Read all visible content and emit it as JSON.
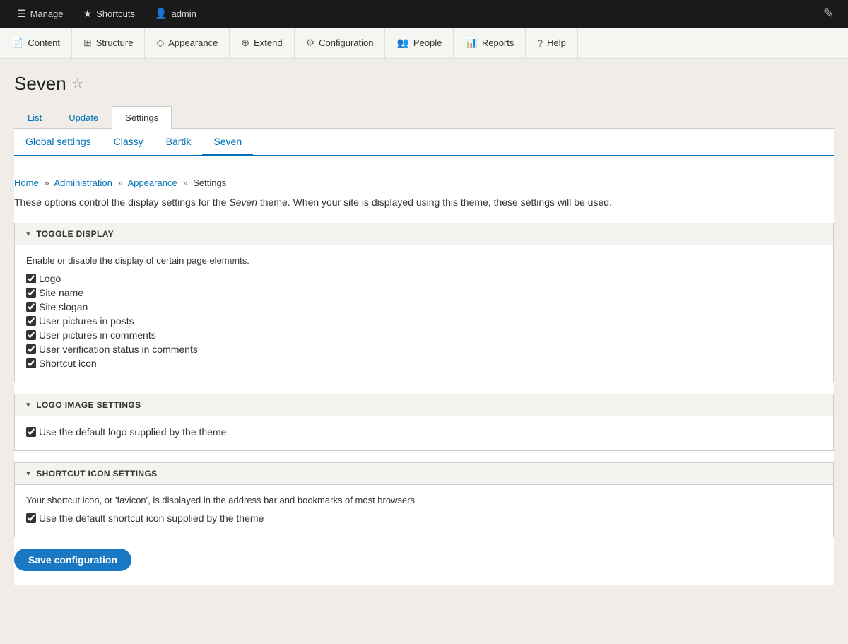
{
  "adminBar": {
    "manage_label": "Manage",
    "shortcuts_label": "Shortcuts",
    "admin_label": "admin",
    "manage_icon": "☰",
    "shortcuts_icon": "★",
    "admin_icon": "👤",
    "edit_icon": "✎"
  },
  "mainNav": {
    "items": [
      {
        "id": "content",
        "label": "Content",
        "icon": "📄"
      },
      {
        "id": "structure",
        "label": "Structure",
        "icon": "⊞"
      },
      {
        "id": "appearance",
        "label": "Appearance",
        "icon": "◇"
      },
      {
        "id": "extend",
        "label": "Extend",
        "icon": "⊕"
      },
      {
        "id": "configuration",
        "label": "Configuration",
        "icon": "⚙"
      },
      {
        "id": "people",
        "label": "People",
        "icon": "👥"
      },
      {
        "id": "reports",
        "label": "Reports",
        "icon": "📊"
      },
      {
        "id": "help",
        "label": "Help",
        "icon": "?"
      }
    ]
  },
  "pageTitle": "Seven",
  "tabs": [
    {
      "id": "list",
      "label": "List",
      "active": false
    },
    {
      "id": "update",
      "label": "Update",
      "active": false
    },
    {
      "id": "settings",
      "label": "Settings",
      "active": true
    }
  ],
  "subTabs": [
    {
      "id": "global-settings",
      "label": "Global settings",
      "active": false
    },
    {
      "id": "classy",
      "label": "Classy",
      "active": false
    },
    {
      "id": "bartik",
      "label": "Bartik",
      "active": false
    },
    {
      "id": "seven",
      "label": "Seven",
      "active": true
    }
  ],
  "breadcrumb": {
    "home": "Home",
    "administration": "Administration",
    "appearance": "Appearance",
    "settings": "Settings"
  },
  "introText": "These options control the display settings for the ",
  "introTheme": "Seven",
  "introTextEnd": " theme. When your site is displayed using this theme, these settings will be used.",
  "toggleDisplay": {
    "legend": "TOGGLE DISPLAY",
    "description": "Enable or disable the display of certain page elements.",
    "items": [
      {
        "id": "logo",
        "label": "Logo",
        "checked": true
      },
      {
        "id": "site-name",
        "label": "Site name",
        "checked": true
      },
      {
        "id": "site-slogan",
        "label": "Site slogan",
        "checked": true
      },
      {
        "id": "user-pictures-posts",
        "label": "User pictures in posts",
        "checked": true
      },
      {
        "id": "user-pictures-comments",
        "label": "User pictures in comments",
        "checked": true
      },
      {
        "id": "user-verification-status",
        "label": "User verification status in comments",
        "checked": true
      },
      {
        "id": "shortcut-icon",
        "label": "Shortcut icon",
        "checked": true
      }
    ]
  },
  "logoImageSettings": {
    "legend": "LOGO IMAGE SETTINGS",
    "items": [
      {
        "id": "default-logo",
        "label": "Use the default logo supplied by the theme",
        "checked": true
      }
    ]
  },
  "shortcutIconSettings": {
    "legend": "SHORTCUT ICON SETTINGS",
    "description": "Your shortcut icon, or 'favicon', is displayed in the address bar and bookmarks of most browsers.",
    "items": [
      {
        "id": "default-shortcut",
        "label": "Use the default shortcut icon supplied by the theme",
        "checked": true
      }
    ]
  },
  "saveButton": "Save configuration"
}
